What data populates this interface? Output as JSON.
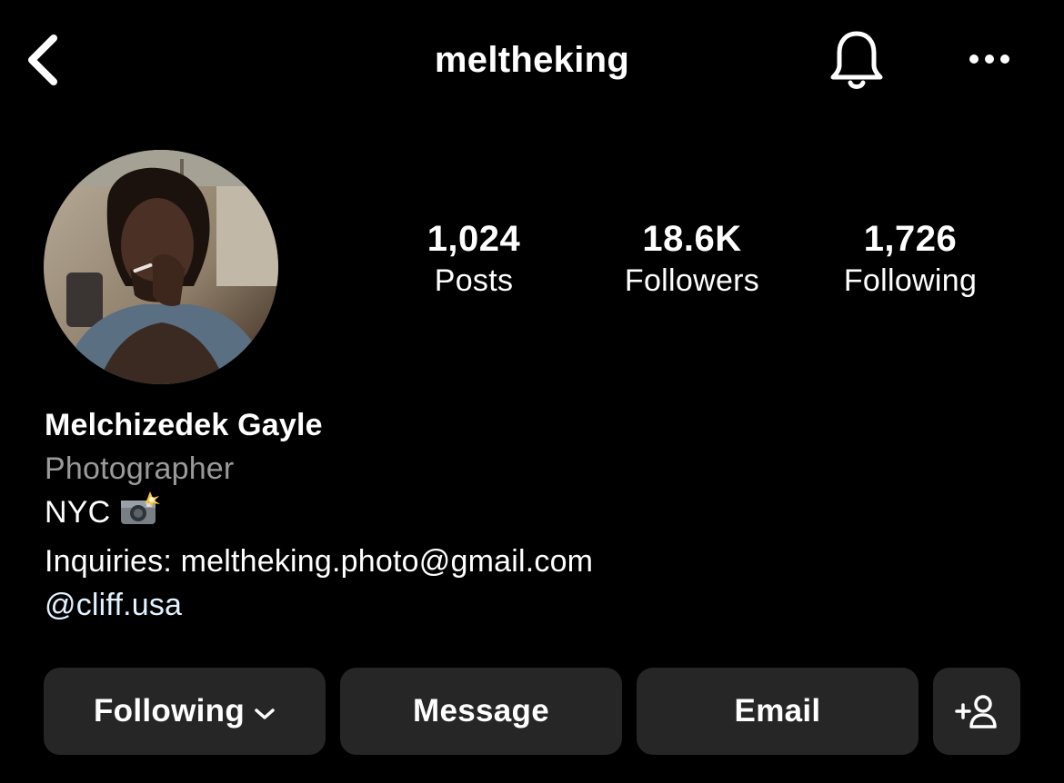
{
  "header": {
    "username": "meltheking",
    "back_icon": "chevron-left-icon",
    "bell_icon": "bell-icon",
    "more_icon": "more-horizontal-icon"
  },
  "stats": {
    "posts": {
      "value": "1,024",
      "label": "Posts"
    },
    "followers": {
      "value": "18.6K",
      "label": "Followers"
    },
    "following": {
      "value": "1,726",
      "label": "Following"
    }
  },
  "bio": {
    "name": "Melchizedek Gayle",
    "category": "Photographer",
    "location": "NYC",
    "location_icon": "camera-flash-icon",
    "inquiries": "Inquiries: meltheking.photo@gmail.com",
    "link": "@cliff.usa"
  },
  "actions": {
    "following_label": "Following",
    "message_label": "Message",
    "email_label": "Email",
    "add_icon": "add-person-icon"
  },
  "colors": {
    "background": "#000000",
    "text": "#ffffff",
    "category_text": "#9a9a9a",
    "link_text": "#e0f1ff",
    "button_bg": "#262626"
  }
}
